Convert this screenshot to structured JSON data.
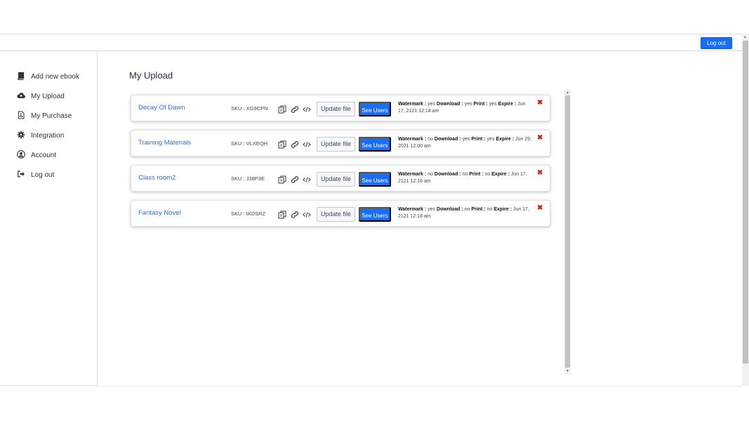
{
  "header": {
    "logout_label": "Log out"
  },
  "sidebar": {
    "items": [
      {
        "label": "Add new ebook",
        "icon": "book-icon"
      },
      {
        "label": "My Upload",
        "icon": "cloud-upload-icon"
      },
      {
        "label": "My Purchase",
        "icon": "pdf-file-icon"
      },
      {
        "label": "Integration",
        "icon": "gear-icon"
      },
      {
        "label": "Account",
        "icon": "user-icon"
      },
      {
        "label": "Log out",
        "icon": "sign-out-icon"
      }
    ]
  },
  "main": {
    "title": "My Upload",
    "update_label": "Update file",
    "see_users_label": "See Users",
    "labels": {
      "watermark": "Watermark :",
      "download": "Download :",
      "print": "Print :",
      "expire": "Expire :"
    },
    "books": [
      {
        "title": "Decay Of Dawn",
        "sku": "SKU : XG9CPN",
        "watermark": "yes",
        "download": "yes",
        "print": "yes",
        "expire": "Jun 17, 2121 12:14 am"
      },
      {
        "title": "Training Materials",
        "sku": "SKU : VLXEQH",
        "watermark": "no",
        "download": "yes",
        "print": "yes",
        "expire": "Jun 29, 2021 12:00 am"
      },
      {
        "title": "Class room2",
        "sku": "SKU : J38P3E",
        "watermark": "no",
        "download": "no",
        "print": "no",
        "expire": "Jun 17, 2121 12:16 am"
      },
      {
        "title": "Fantasy Novel",
        "sku": "SKU : IKDSRZ",
        "watermark": "yes",
        "download": "no",
        "print": "no",
        "expire": "Jun 17, 2121 12:18 am"
      }
    ]
  },
  "colors": {
    "primary": "#1a6ef5",
    "link": "#2f6fd6",
    "delete": "#e31a1a"
  }
}
